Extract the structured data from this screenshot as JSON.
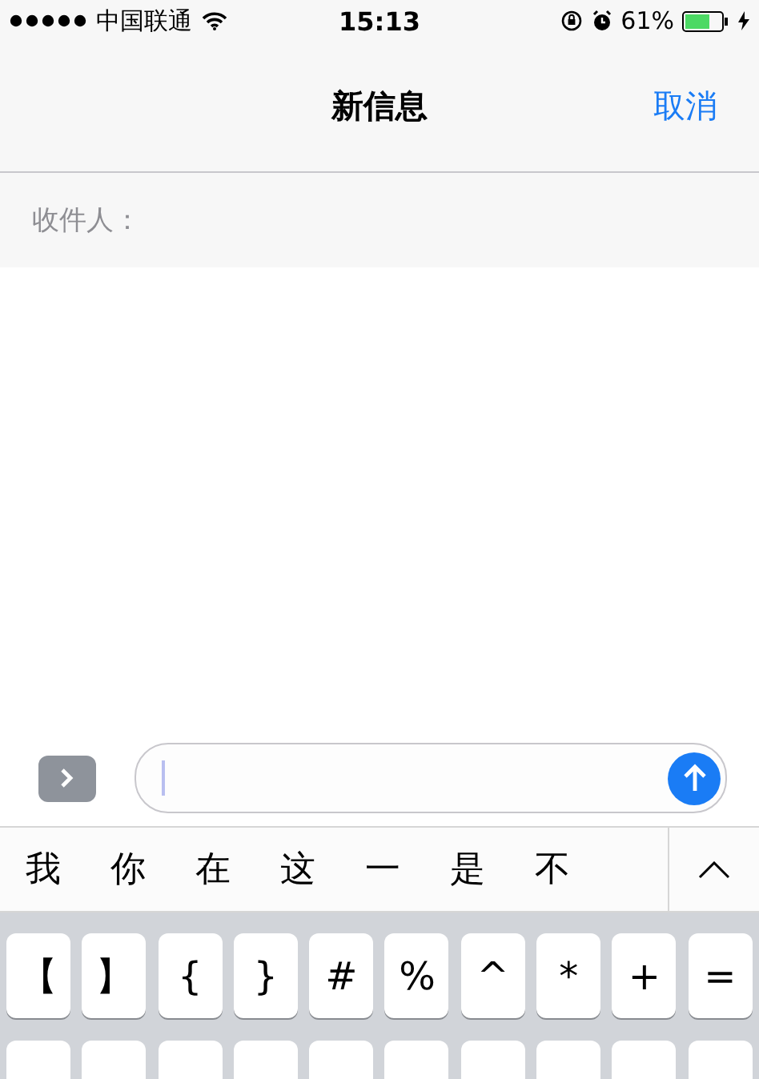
{
  "status_bar": {
    "carrier": "中国联通",
    "time": "15:13",
    "battery_percent": "61%",
    "charging": true
  },
  "nav": {
    "title": "新信息",
    "cancel": "取消"
  },
  "recipient": {
    "label": "收件人："
  },
  "candidates": [
    "我",
    "你",
    "在",
    "这",
    "一",
    "是",
    "不"
  ],
  "keyboard": {
    "rows": [
      [
        "【",
        "】",
        "{",
        "}",
        "#",
        "%",
        "^",
        "*",
        "+",
        "="
      ]
    ]
  }
}
